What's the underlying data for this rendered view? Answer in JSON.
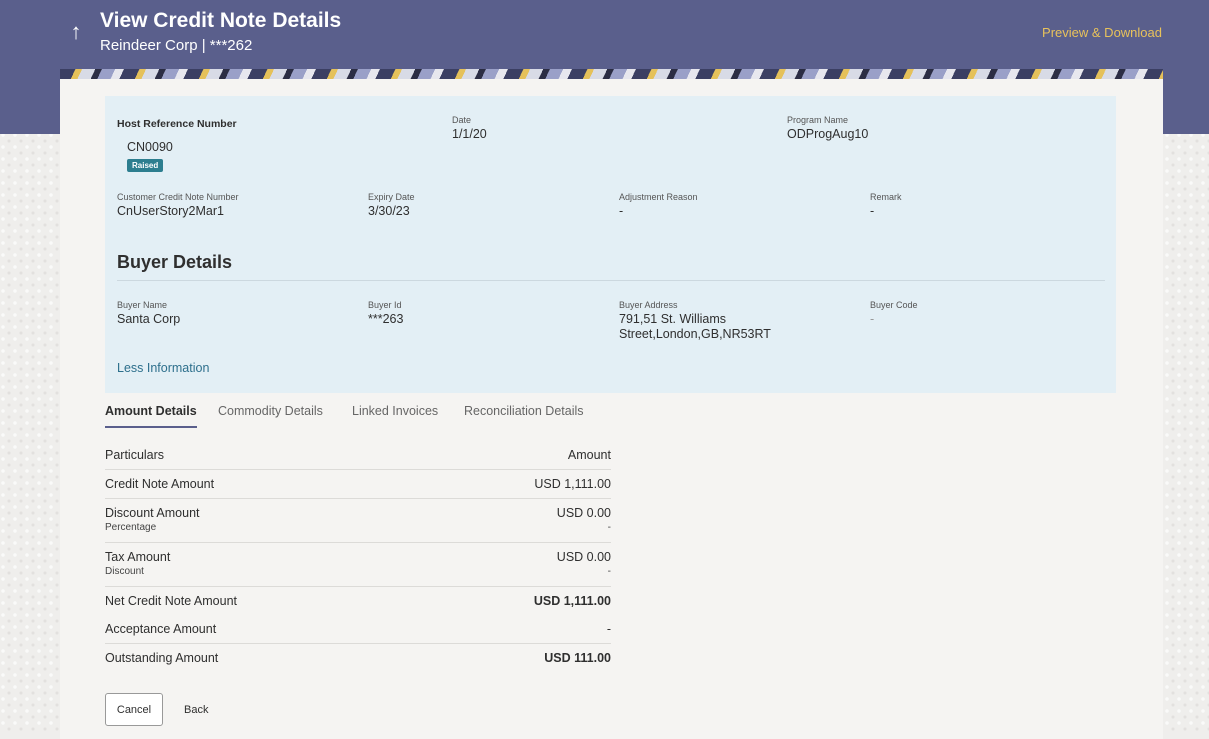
{
  "header": {
    "title": "View Credit Note Details",
    "subtitle": "Reindeer Corp | ***262",
    "preview_download": "Preview & Download",
    "back_icon": "arrow-up-icon"
  },
  "details": {
    "host_reference": {
      "label": "Host Reference Number",
      "value": "CN0090",
      "status": "Raised"
    },
    "date": {
      "label": "Date",
      "value": "1/1/20"
    },
    "program_name": {
      "label": "Program Name",
      "value": "ODProgAug10"
    },
    "customer_credit_note": {
      "label": "Customer Credit Note Number",
      "value": "CnUserStory2Mar1"
    },
    "expiry_date": {
      "label": "Expiry Date",
      "value": "3/30/23"
    },
    "adjustment_reason": {
      "label": "Adjustment Reason",
      "value": "-"
    },
    "remark": {
      "label": "Remark",
      "value": "-"
    }
  },
  "buyer": {
    "section_title": "Buyer Details",
    "name": {
      "label": "Buyer Name",
      "value": "Santa Corp"
    },
    "id": {
      "label": "Buyer Id",
      "value": "***263"
    },
    "address": {
      "label": "Buyer Address",
      "line1": "791,51 St. Williams",
      "line2": "Street,London,GB,NR53RT"
    },
    "code": {
      "label": "Buyer Code",
      "value": "-"
    },
    "less_info": "Less Information"
  },
  "tabs": [
    "Amount Details",
    "Commodity Details",
    "Linked Invoices",
    "Reconciliation Details"
  ],
  "amounts": {
    "header": {
      "name": "Particulars",
      "amount": "Amount"
    },
    "credit_note": {
      "name": "Credit Note Amount",
      "amount": "USD 1,111.00"
    },
    "discount": {
      "name": "Discount Amount",
      "amount": "USD 0.00",
      "sub": "Percentage",
      "subval": "-"
    },
    "tax": {
      "name": "Tax Amount",
      "amount": "USD 0.00",
      "sub": "Discount",
      "subval": "-"
    },
    "net": {
      "name": "Net Credit Note Amount",
      "amount": "USD 1,111.00"
    },
    "acceptance": {
      "name": "Acceptance Amount",
      "amount": "-"
    },
    "outstanding": {
      "name": "Outstanding Amount",
      "amount": "USD 111.00"
    }
  },
  "buttons": {
    "cancel": "Cancel",
    "back": "Back"
  },
  "colors": {
    "header": "#5a5f8c",
    "accent_link": "#e8c25b",
    "badge": "#2d7e8f",
    "panel": "#e3eff5"
  }
}
